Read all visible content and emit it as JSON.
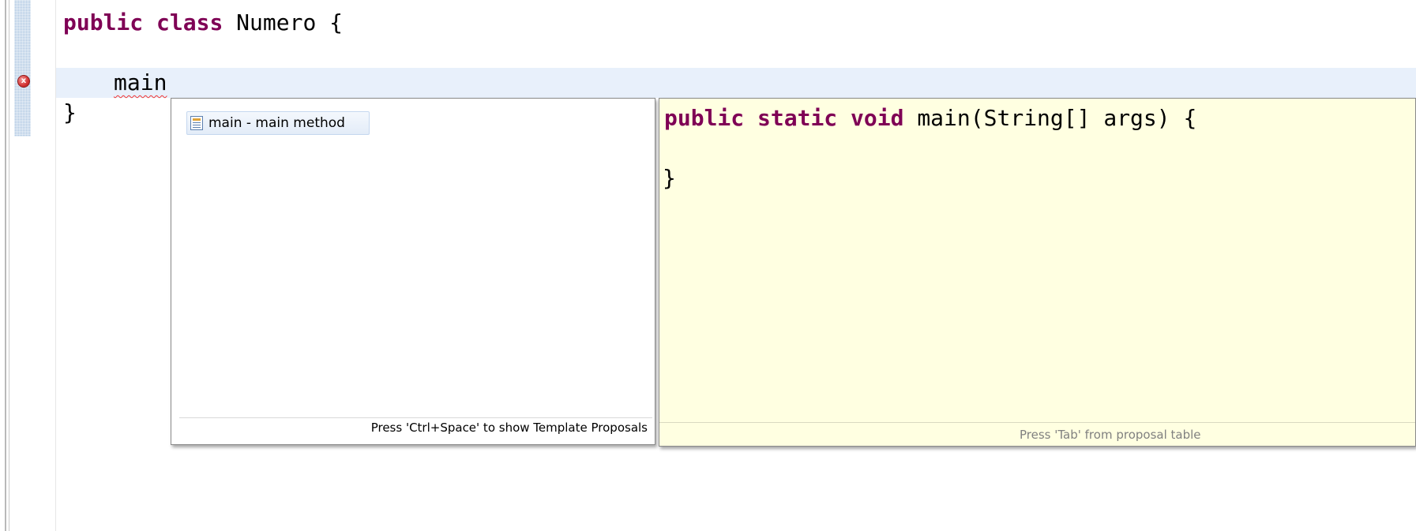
{
  "editor": {
    "lines": {
      "class_kw1": "public",
      "class_kw2": "class",
      "class_rest": "Numero {",
      "typed": "main",
      "closing": "}"
    },
    "error_marker": "x"
  },
  "proposal_popup": {
    "items": [
      {
        "label": "main - main method",
        "icon": "template-doc-icon"
      }
    ],
    "footer": "Press 'Ctrl+Space' to show Template Proposals"
  },
  "info_popup": {
    "code": {
      "kw1": "public",
      "kw2": "static",
      "kw3": "void",
      "sig": "main(String[] args) {",
      "close": "}"
    },
    "footer": "Press 'Tab' from proposal table"
  },
  "colors": {
    "keyword": "#7f0055",
    "current_line": "#e8f0fb",
    "info_background": "#ffffe1",
    "error": "#d33333"
  }
}
